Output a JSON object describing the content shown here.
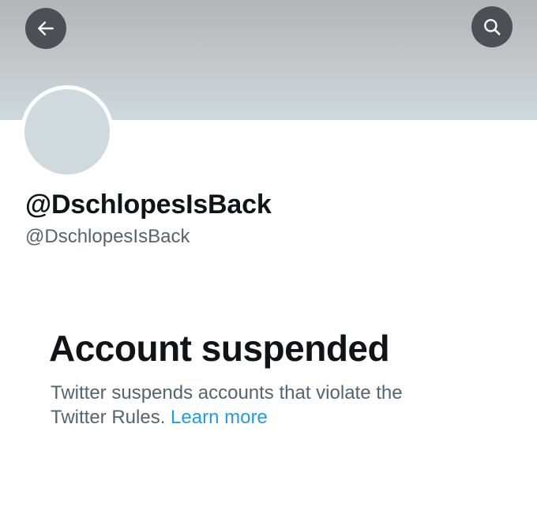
{
  "header": {
    "back_icon": "arrow-left-icon",
    "search_icon": "search-icon"
  },
  "profile": {
    "display_name": "@DschlopesIsBack",
    "handle": "@DschlopesIsBack"
  },
  "suspension": {
    "title": "Account suspended",
    "description_line1": "Twitter suspends accounts that violate the",
    "description_line2": "Twitter Rules.",
    "link_label": "Learn more"
  },
  "colors": {
    "banner_top": "#b3b5b8",
    "banner_bottom": "#cfd9de",
    "button_bg": "#4c5054",
    "avatar_bg": "#cfd9de",
    "text_primary": "#0f1419",
    "text_secondary": "#536471",
    "link": "#1d9bf0"
  }
}
